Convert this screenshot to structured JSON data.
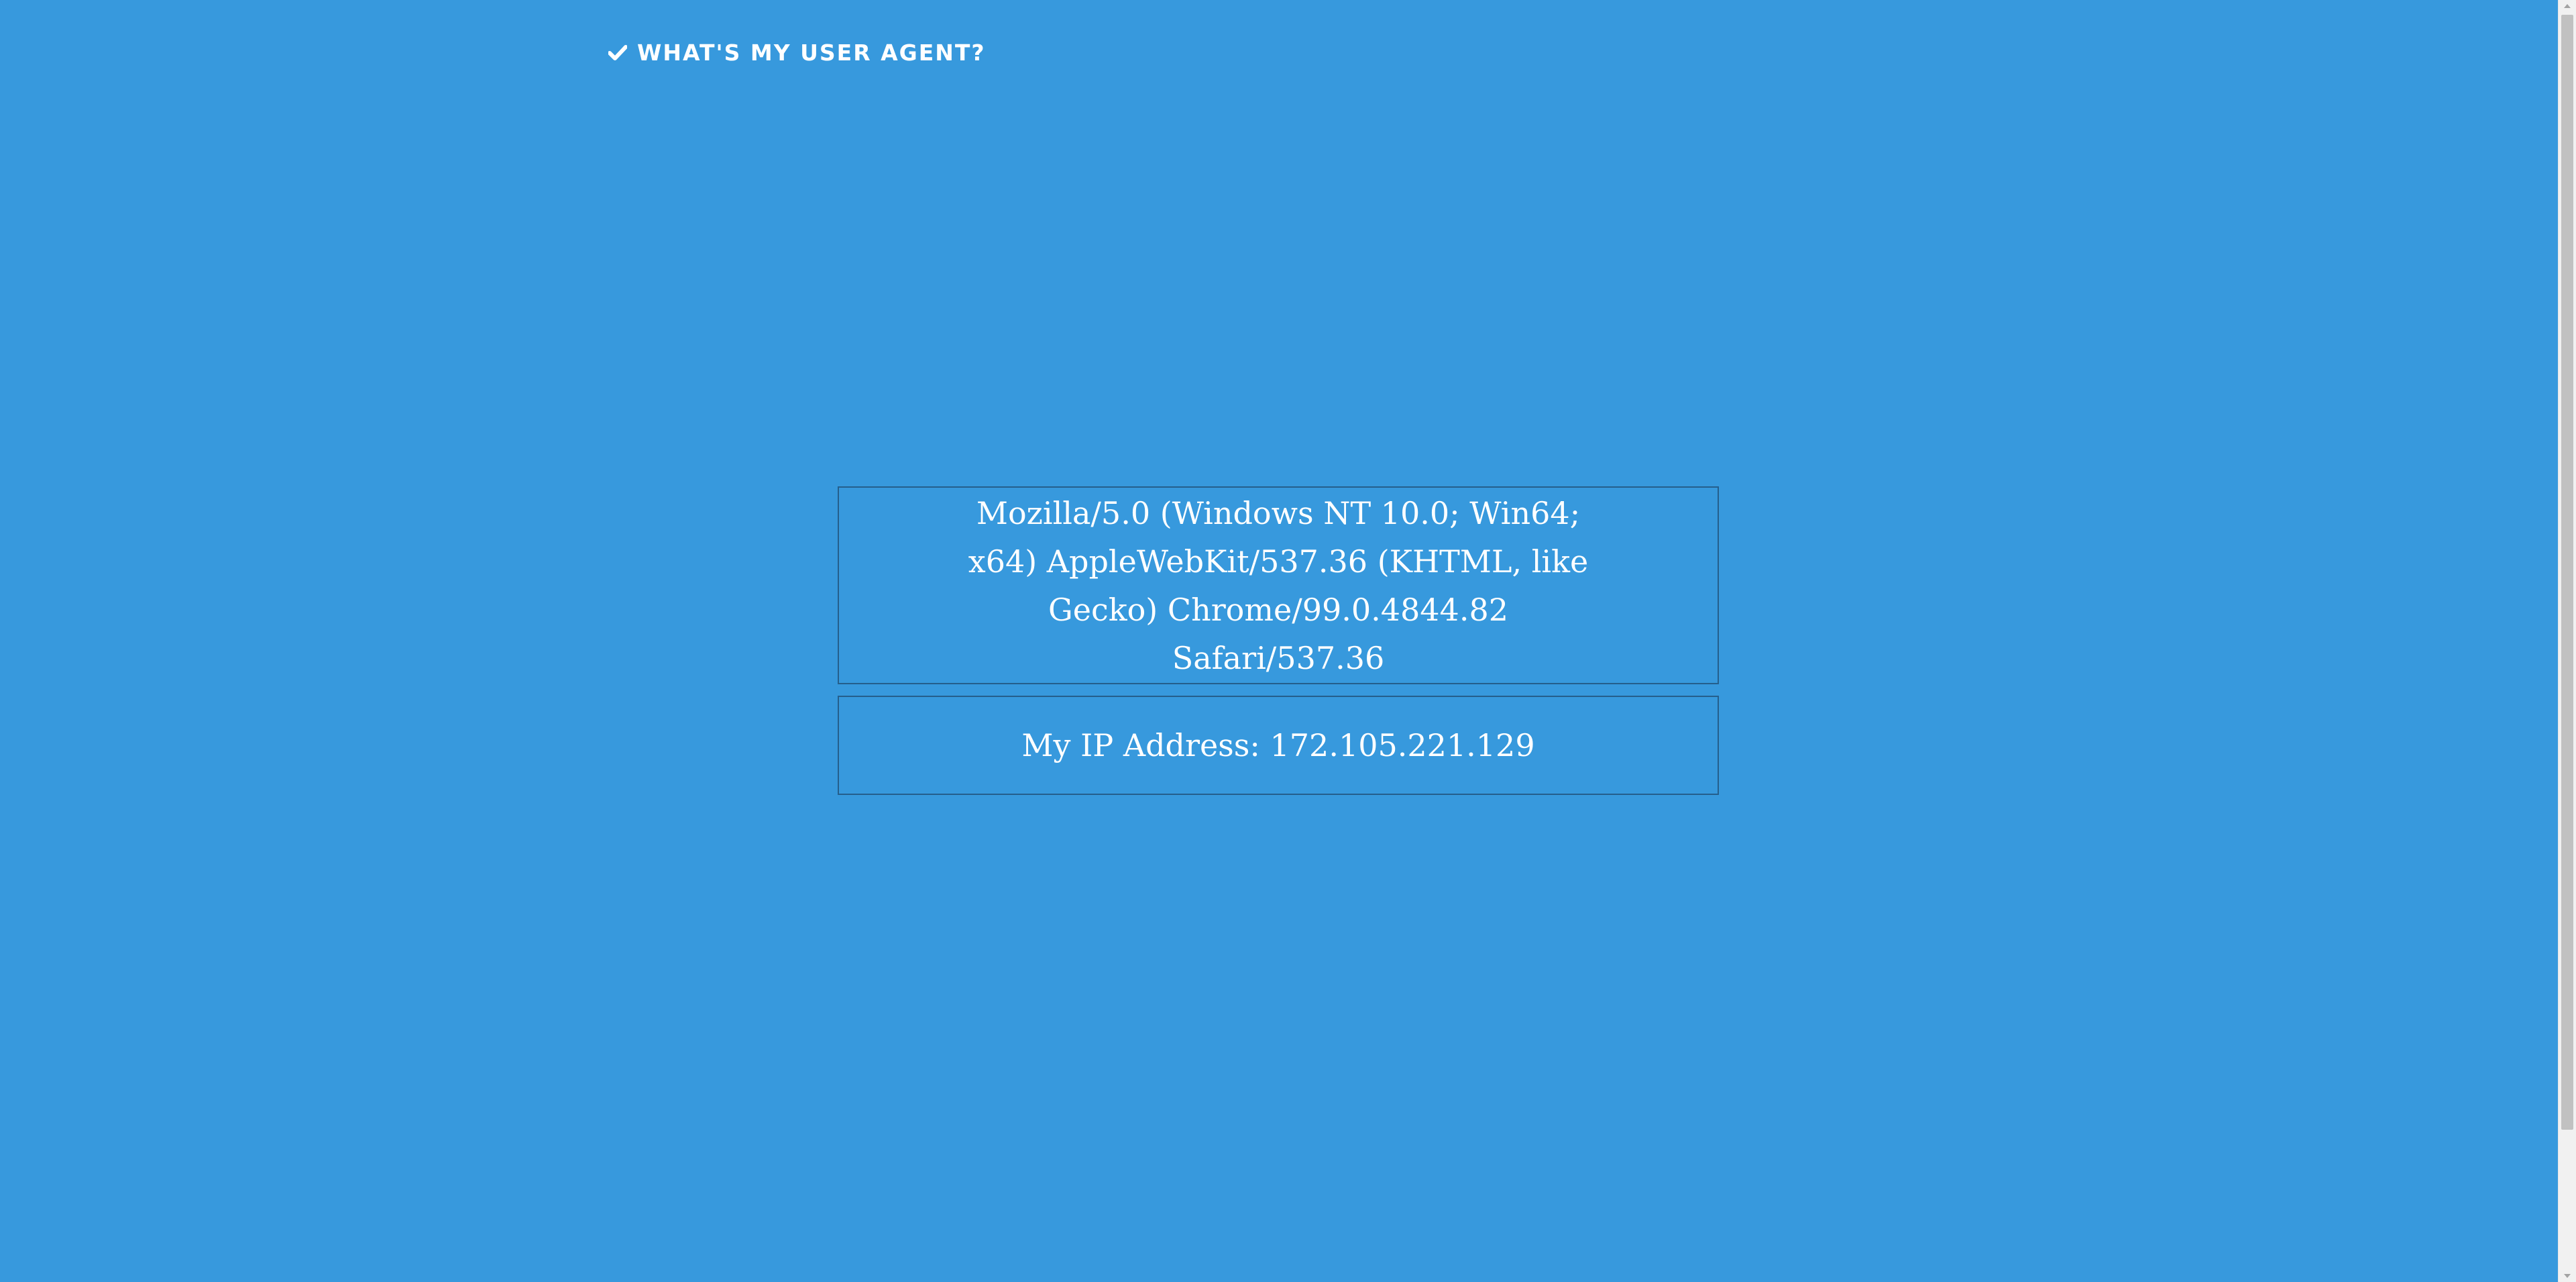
{
  "header": {
    "brand_icon": "check-icon",
    "brand_label": "WHAT'S MY USER AGENT?"
  },
  "user_agent": {
    "text": "Mozilla/5.0 (Windows NT 10.0; Win64; x64) AppleWebKit/537.36 (KHTML, like Gecko) Chrome/99.0.4844.82 Safari/537.36"
  },
  "ip": {
    "label": "My IP Address:",
    "value": "172.105.221.129"
  },
  "colors": {
    "background": "#3799dd",
    "box_border": "#255f8c",
    "text": "#ffffff"
  }
}
